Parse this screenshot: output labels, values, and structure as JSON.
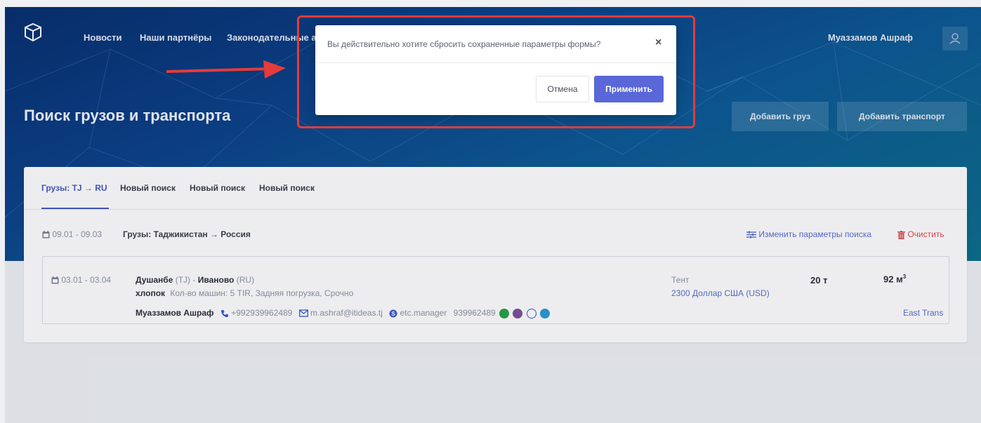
{
  "nav": {
    "items": [
      "Новости",
      "Наши партнёры",
      "Законодательные а"
    ],
    "user_name": "Муаззамов Ашраф",
    "user_icon": "user-icon"
  },
  "hero": {
    "title": "Поиск грузов и транспорта",
    "add_cargo": "Добавить груз",
    "add_transport": "Добавить транспорт"
  },
  "tabs": [
    "Грузы: TJ → RU",
    "Новый поиск",
    "Новый поиск",
    "Новый поиск"
  ],
  "filter": {
    "dates": "09.01 - 09.03",
    "route": "Грузы: Таджикистан → Россия",
    "edit_label": "Изменить параметры поиска",
    "clear_label": "Очистить"
  },
  "listing": {
    "dates": "03.01 - 03.04",
    "from_city": "Душанбе",
    "from_code": "(TJ)",
    "separator": " - ",
    "to_city": "Иваново",
    "to_code": "(RU)",
    "cargo": "хлопок",
    "details": "Кол-во машин: 5  TIR, Задняя погрузка, Срочно",
    "contact_name": "Муаззамов Ашраф",
    "phone": "+992939962489",
    "email": "m.ashraf@itideas.tj",
    "skype": "etc.manager",
    "messenger_number": "939962489",
    "body_type": "Тент",
    "price": "2300 Доллар США (USD)",
    "weight": "20 т",
    "volume": "92 м",
    "volume_sup": "3",
    "company": "East Trans"
  },
  "modal": {
    "message": "Вы действительно хотите сбросить сохраненные параметры формы?",
    "close": "×",
    "cancel": "Отмена",
    "apply": "Применить"
  },
  "colors": {
    "accent": "#5a67d8",
    "highlight": "#e53b3b",
    "whatsapp": "#25a244",
    "viber": "#7b519d",
    "telegram": "#2a9bd8"
  }
}
